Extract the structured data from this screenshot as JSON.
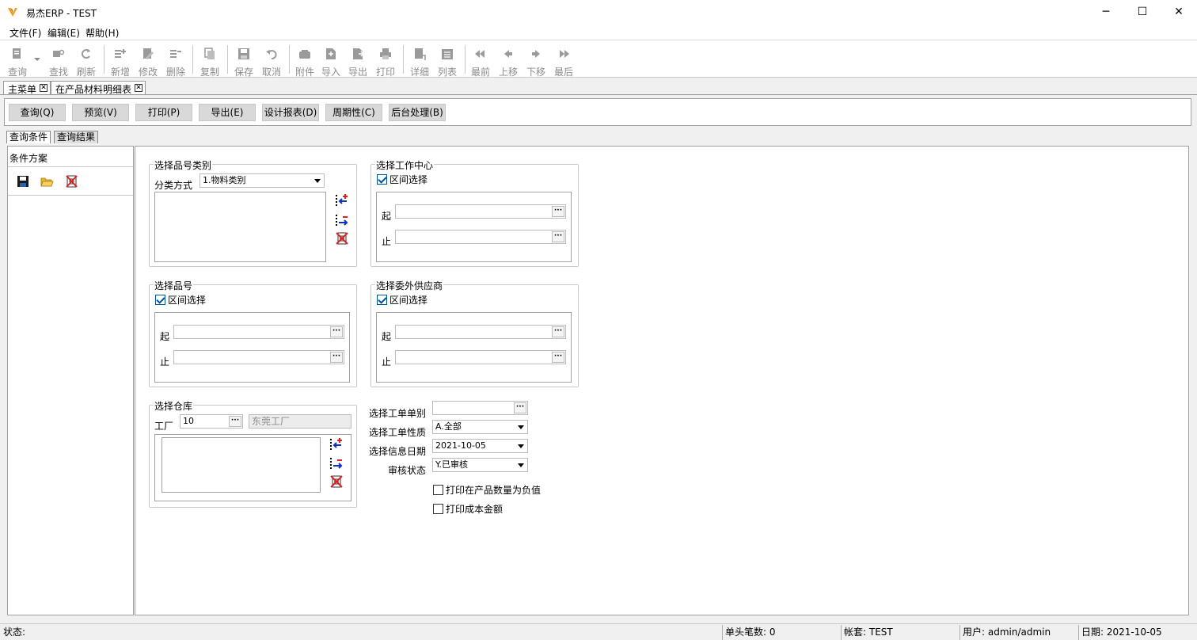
{
  "window": {
    "title": "易杰ERP - TEST",
    "minimize": "─",
    "maximize": "☐",
    "close": "✕"
  },
  "menu": [
    "文件(F)",
    "编辑(E)",
    "帮助(H)"
  ],
  "toolbar": [
    "查询",
    "查找",
    "刷新",
    "新增",
    "修改",
    "删除",
    "复制",
    "保存",
    "取消",
    "附件",
    "导入",
    "导出",
    "打印",
    "详细",
    "列表",
    "最前",
    "上移",
    "下移",
    "最后"
  ],
  "doc_tabs": [
    {
      "label": "主菜单",
      "close": "✕"
    },
    {
      "label": "在产品材料明细表",
      "close": "✕"
    }
  ],
  "actions": [
    "查询(Q)",
    "预览(V)",
    "打印(P)",
    "导出(E)",
    "设计报表(D)",
    "周期性(C)",
    "后台处理(B)"
  ],
  "sub_tabs": [
    "查询条件",
    "查询结果"
  ],
  "left_panel": {
    "title": "条件方案"
  },
  "form": {
    "category": {
      "legend": "选择品号类别",
      "method_label": "分类方式",
      "method_value": "1.物料类别"
    },
    "workcenter": {
      "legend": "选择工作中心",
      "range_label": "区间选择",
      "range_checked": true,
      "from_label": "起",
      "to_label": "止"
    },
    "item": {
      "legend": "选择品号",
      "range_label": "区间选择",
      "range_checked": true,
      "from_label": "起",
      "to_label": "止"
    },
    "supplier": {
      "legend": "选择委外供应商",
      "range_label": "区间选择",
      "range_checked": true,
      "from_label": "起",
      "to_label": "止"
    },
    "warehouse": {
      "legend": "选择仓库",
      "factory_label": "工厂",
      "factory_code": "10",
      "factory_name": "东莞工厂"
    },
    "wo_type_label": "选择工单单别",
    "wo_type_value": "",
    "wo_nature_label": "选择工单性质",
    "wo_nature_value": "A.全部",
    "info_date_label": "选择信息日期",
    "info_date_value": "2021-10-05",
    "audit_label": "审核状态",
    "audit_value": "Y.已审核",
    "opt_negative": "打印在产品数量为负值",
    "opt_cost": "打印成本金额",
    "ellipsis": "···"
  },
  "status": {
    "state": "状态:",
    "head_count": "单头笔数: 0",
    "account": "帐套: TEST",
    "user": "用户: admin/admin",
    "date": "日期: 2021-10-05"
  }
}
